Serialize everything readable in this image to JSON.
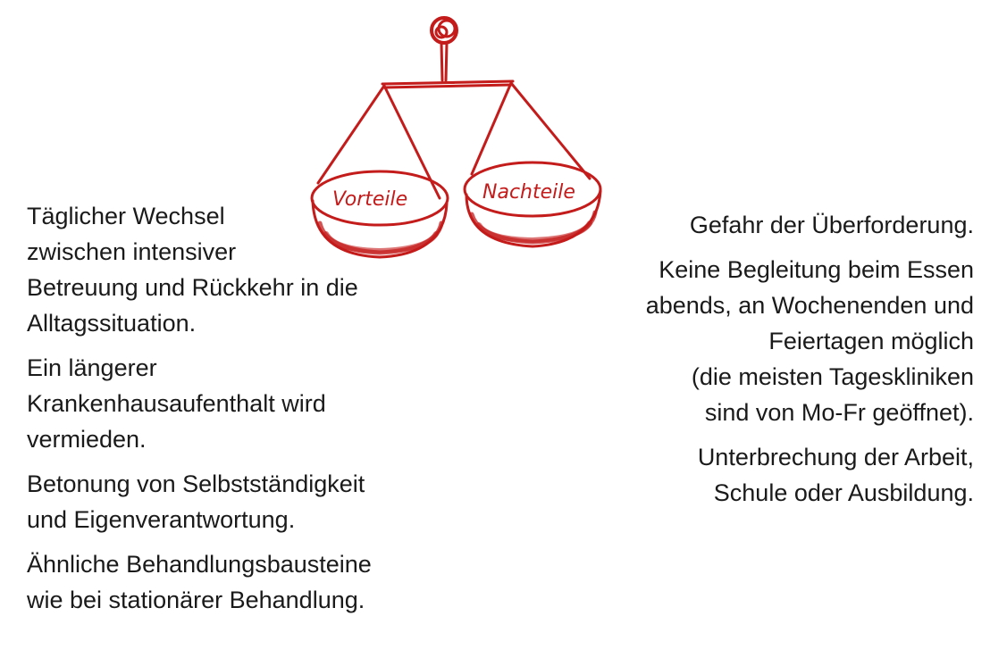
{
  "scale": {
    "left_pan_label": "Vorteile",
    "right_pan_label": "Nachteile",
    "ink_color": "#c41b1b"
  },
  "advantages": [
    {
      "lines": [
        "Täglicher Wechsel",
        "zwischen intensiver",
        "Betreuung und Rückkehr in die",
        "Alltagssituation."
      ]
    },
    {
      "lines": [
        "Ein längerer",
        "Krankenhausaufenthalt wird",
        "vermieden."
      ]
    },
    {
      "lines": [
        "Betonung von Selbstständigkeit",
        "und Eigenverantwortung."
      ]
    },
    {
      "lines": [
        "Ähnliche Behandlungsbausteine",
        "wie bei stationärer Behandlung."
      ]
    }
  ],
  "disadvantages": [
    {
      "lines": [
        "Gefahr der Überforderung."
      ]
    },
    {
      "lines": [
        "Keine Begleitung beim Essen",
        "abends, an Wochenenden und",
        "Feiertagen möglich",
        "(die meisten Tageskliniken",
        "sind von Mo-Fr geöffnet)."
      ]
    },
    {
      "lines": [
        "Unterbrechung der Arbeit,",
        "Schule oder Ausbildung."
      ]
    }
  ]
}
